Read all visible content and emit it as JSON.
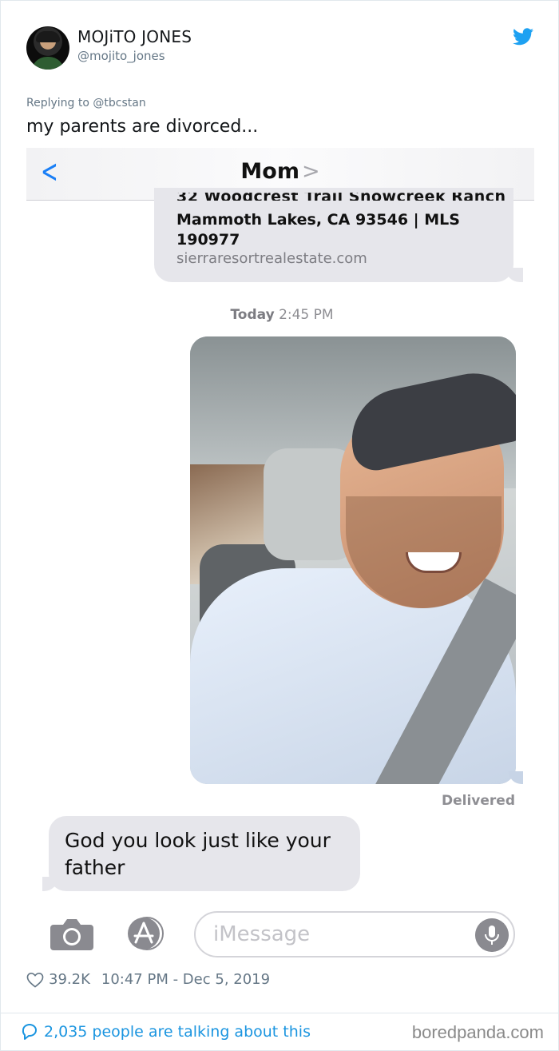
{
  "tweet": {
    "author_name": "MOJiTO JONES",
    "author_handle": "@mojito_jones",
    "replying_to": "Replying to @tbcstan",
    "text": "my parents are divorced...",
    "likes": "39.2K",
    "timestamp": "10:47 PM - Dec 5, 2019",
    "talking": "2,035 people are talking about this",
    "brand_color": "#1da1f2"
  },
  "imessage": {
    "back_icon": "chevron-left-icon",
    "contact_name": "Mom",
    "contact_chevron": ">",
    "cut_line": "32 Woodcrest Trail Snowcreek Ranch",
    "address": "Mammoth Lakes, CA 93546 | MLS 190977",
    "link": "sierraresortrealestate.com",
    "time_day": "Today",
    "time_clock": "2:45 PM",
    "delivered": "Delivered",
    "incoming_message": "God you look just like your father",
    "input_placeholder": "iMessage",
    "accent_color": "#1a7ff6",
    "bubble_gray": "#e6e6eb"
  },
  "watermark": "boredpanda.com"
}
